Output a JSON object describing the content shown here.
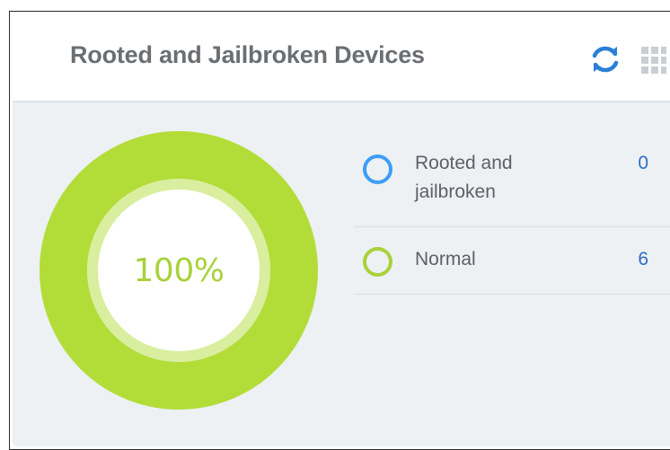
{
  "widget": {
    "title": "Rooted and Jailbroken Devices",
    "refresh_icon": "refresh-icon",
    "drag_icon": "grid-drag-icon"
  },
  "donut": {
    "center_label": "100%",
    "color_primary": "#b2dd38",
    "color_inner_ring": "#d9ee9e"
  },
  "legend": {
    "items": [
      {
        "label": "Rooted and jailbroken",
        "value": "0",
        "color": "#3d9df5"
      },
      {
        "label": "Normal",
        "value": "6",
        "color": "#a8d23b"
      }
    ]
  },
  "chart_data": {
    "type": "pie",
    "categories": [
      "Rooted and jailbroken",
      "Normal"
    ],
    "values": [
      0,
      6
    ]
  }
}
